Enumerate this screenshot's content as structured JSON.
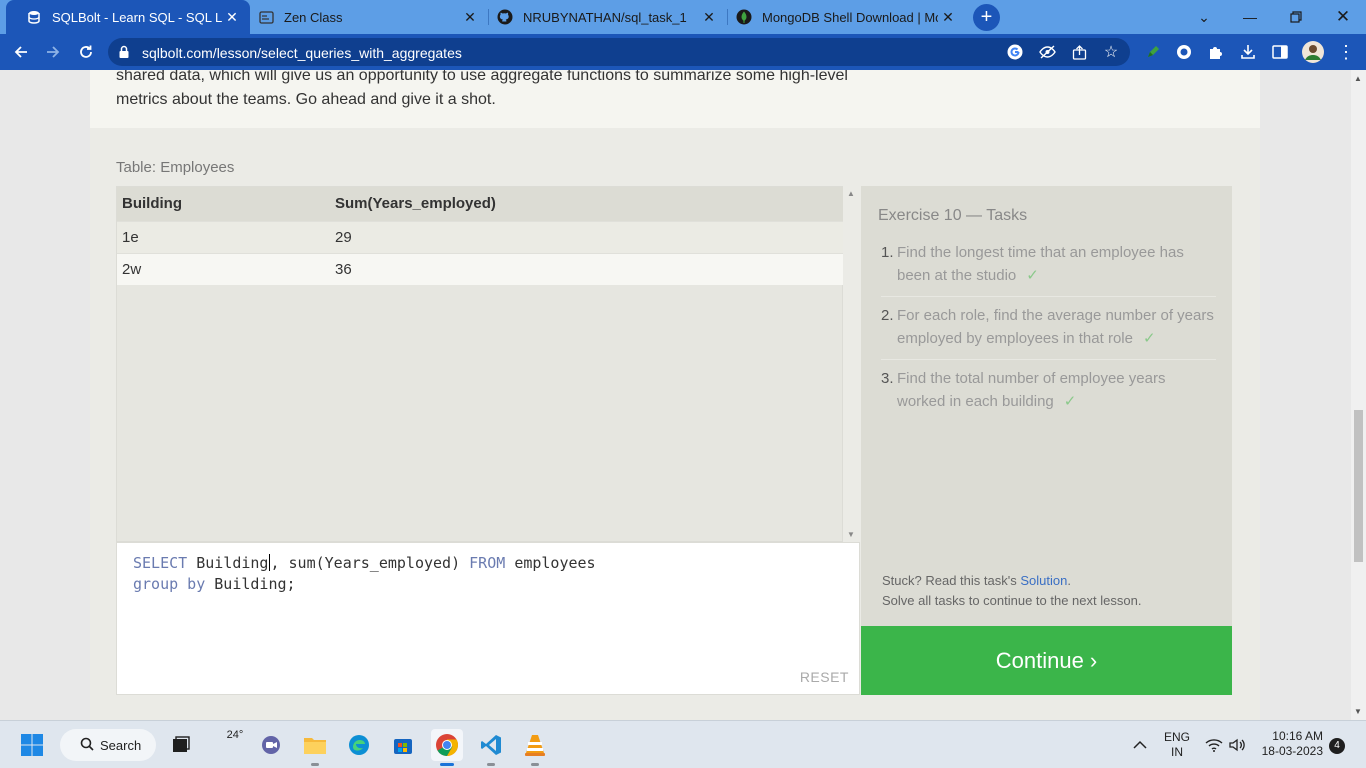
{
  "browser": {
    "tabs": [
      {
        "title": "SQLBolt - Learn SQL - SQL Lesson",
        "active": true
      },
      {
        "title": "Zen Class",
        "active": false
      },
      {
        "title": "NRUBYNATHAN/sql_task_1",
        "active": false
      },
      {
        "title": "MongoDB Shell Download | Mon",
        "active": false
      }
    ],
    "url": "sqlbolt.com/lesson/select_queries_with_aggregates"
  },
  "page": {
    "intro_line1": "shared data, which will give us an opportunity to use aggregate functions to summarize some high-level",
    "intro_line2": "metrics about the teams. Go ahead and give it a shot.",
    "table_caption": "Table: Employees",
    "results": {
      "columns": [
        "Building",
        "Sum(Years_employed)"
      ],
      "rows": [
        [
          "1e",
          "29"
        ],
        [
          "2w",
          "36"
        ]
      ]
    },
    "editor": {
      "sql_line1": [
        "SELECT",
        "Building",
        ", sum(Years_employed)",
        "FROM",
        "employees"
      ],
      "sql_line2": [
        "group by",
        "Building;"
      ],
      "reset_label": "RESET"
    },
    "tasks": {
      "heading": "Exercise 10 — Tasks",
      "items": [
        {
          "num": "1.",
          "text": "Find the longest time that an employee has been at the studio",
          "done": "✓"
        },
        {
          "num": "2.",
          "text": "For each role, find the average number of years employed by employees in that role",
          "done": "✓"
        },
        {
          "num": "3.",
          "text": "Find the total number of employee years worked in each building",
          "done": "✓"
        }
      ],
      "stuck_prefix": "Stuck? Read this task's ",
      "solution_link": "Solution",
      "stuck_suffix": ".",
      "stuck_line2": "Solve all tasks to continue to the next lesson.",
      "continue_label": "Continue ›"
    }
  },
  "taskbar": {
    "search_label": "Search",
    "weather": "24°",
    "lang_line1": "ENG",
    "lang_line2": "IN",
    "time": "10:16 AM",
    "date": "18-03-2023",
    "notifications": "4"
  },
  "colors": {
    "tab_active": "#1c56b8",
    "tabstrip": "#5d9ee6",
    "continue": "#3bb54a",
    "link": "#3a6fc4"
  }
}
